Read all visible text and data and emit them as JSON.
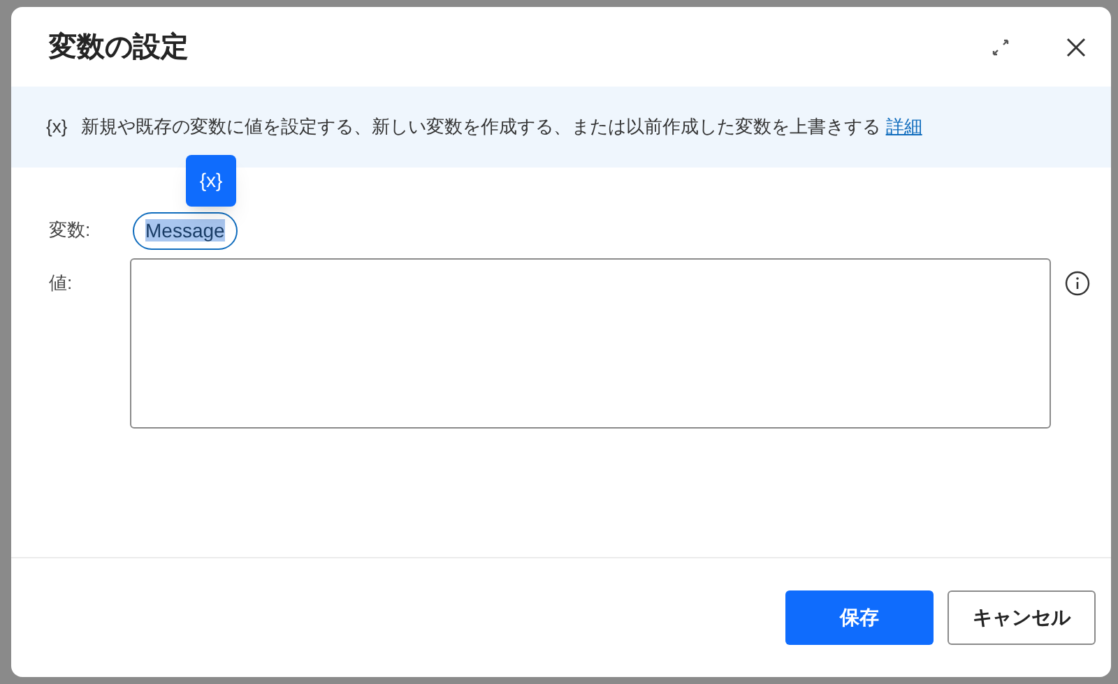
{
  "dialog": {
    "title": "変数の設定"
  },
  "banner": {
    "icon_text": "{x}",
    "text": "新規や既存の変数に値を設定する、新しい変数を作成する、または以前作成した変数を上書きする",
    "link": "詳細"
  },
  "variable_popup": {
    "label": "{x}"
  },
  "fields": [
    {
      "kind": "token",
      "label": "変数:",
      "value": "Message",
      "selected": true
    },
    {
      "kind": "textarea",
      "label": "値:"
    }
  ],
  "buttons": [
    {
      "label": "保存",
      "primary": true
    },
    {
      "label": "キャンセル",
      "primary": false
    }
  ]
}
